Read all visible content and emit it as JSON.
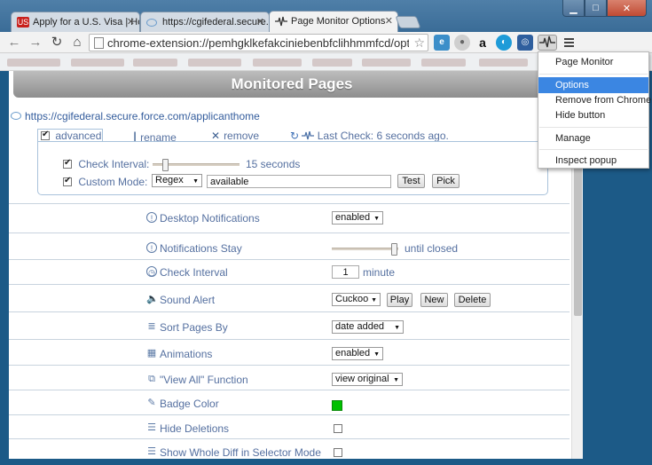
{
  "tabs": [
    {
      "label": "Apply for a U.S. Visa | Hom",
      "favicon": "visa-flag-icon"
    },
    {
      "label": "https://cgifederal.secure.f",
      "favicon": "cloud-icon"
    },
    {
      "label": "Page Monitor Options",
      "favicon": "pulse-icon"
    }
  ],
  "address": {
    "url": "chrome-extension://pemhgklkefakciniebenbfclihhmmfcd/options."
  },
  "page": {
    "title": "Monitored Pages",
    "monitored_url": "https://cgifederal.secure.force.com/applicanthome",
    "controls": {
      "advanced": "advanced",
      "rename": "rename",
      "remove": "remove",
      "last_check": "Last Check: 6 seconds ago."
    },
    "advanced": {
      "check_interval_label": "Check Interval:",
      "check_interval_value": "15 seconds",
      "custom_mode_label": "Custom Mode:",
      "mode_select": "Regex",
      "mode_text": "available",
      "test": "Test",
      "pick": "Pick"
    }
  },
  "options": {
    "desktop_notifications": {
      "label": "Desktop Notifications",
      "value": "enabled"
    },
    "notifications_stay": {
      "label": "Notifications Stay",
      "value": "until closed"
    },
    "check_interval": {
      "label": "Check Interval",
      "value": "1",
      "unit": "minute"
    },
    "sound_alert": {
      "label": "Sound Alert",
      "value": "Cuckoo",
      "play": "Play",
      "new": "New",
      "delete": "Delete"
    },
    "sort_pages": {
      "label": "Sort Pages By",
      "value": "date added"
    },
    "animations": {
      "label": "Animations",
      "value": "enabled"
    },
    "view_all": {
      "label": "\"View All\" Function",
      "value": "view original"
    },
    "badge_color": {
      "label": "Badge Color",
      "color": "#00c000"
    },
    "hide_deletions": {
      "label": "Hide Deletions"
    },
    "whole_diff": {
      "label": "Show Whole Diff in Selector Mode"
    }
  },
  "menu": {
    "title": "Page Monitor",
    "items": [
      "Options",
      "Remove from Chrome",
      "Hide button",
      "Manage",
      "Inspect popup"
    ]
  }
}
